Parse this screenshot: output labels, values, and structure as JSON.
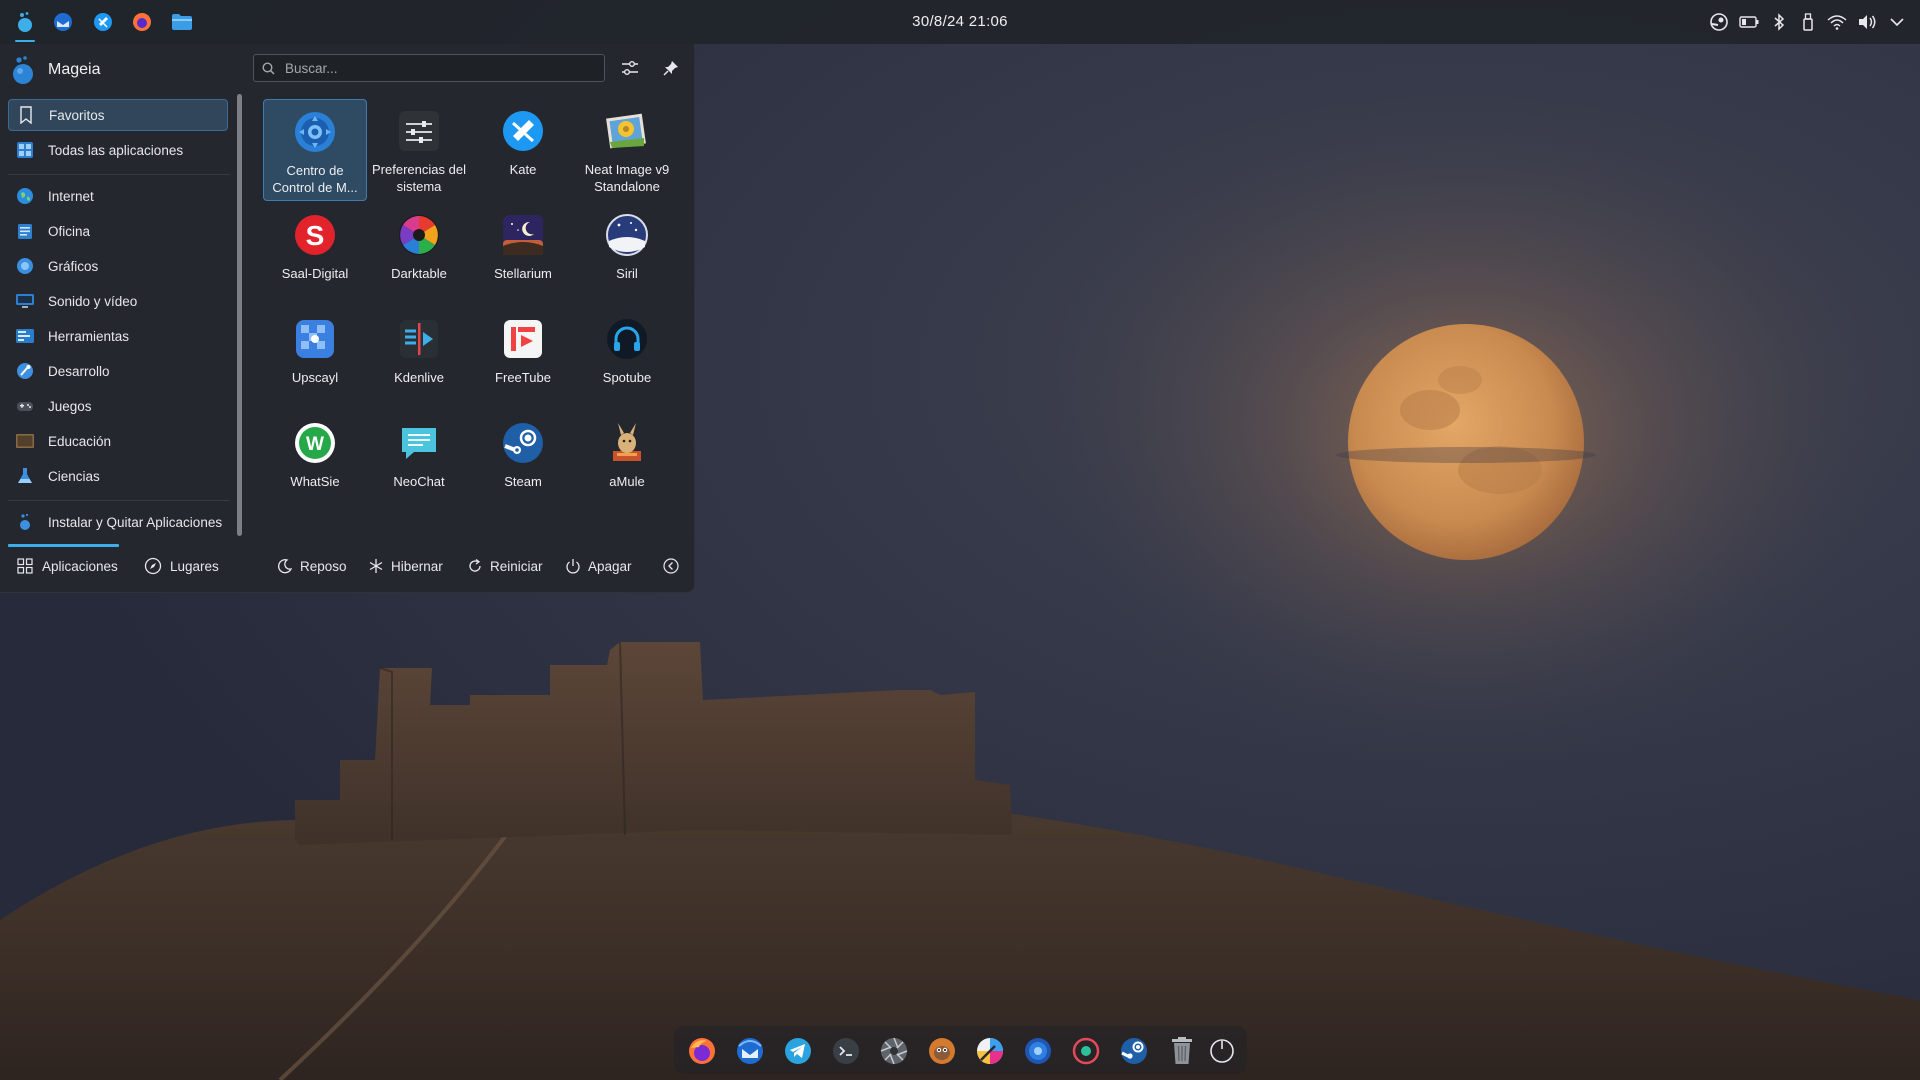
{
  "top_panel": {
    "launchers": [
      {
        "name": "kickoff-menu-icon",
        "color": "#3daee9"
      },
      {
        "name": "thunderbird-icon",
        "color": "#2a7fd6"
      },
      {
        "name": "kate-icon",
        "color": "#1d99f3"
      },
      {
        "name": "firefox-icon",
        "color": "#ff7139"
      },
      {
        "name": "dolphin-folder-icon",
        "color": "#3a9de6"
      }
    ],
    "clock": "30/8/24  21:06",
    "tray": [
      "steam-tray-icon",
      "battery-icon",
      "bluetooth-icon",
      "usb-device-icon",
      "wifi-icon",
      "volume-icon",
      "tray-expand-icon"
    ]
  },
  "menu": {
    "user": "Mageia",
    "search_placeholder": "Buscar...",
    "categories": [
      {
        "label": "Favoritos",
        "icon": "bookmark-icon",
        "selected": true
      },
      {
        "label": "Todas las aplicaciones",
        "icon": "all-apps-icon"
      },
      {
        "label": "Internet",
        "icon": "globe-icon"
      },
      {
        "label": "Oficina",
        "icon": "office-icon"
      },
      {
        "label": "Gráficos",
        "icon": "graphics-icon"
      },
      {
        "label": "Sonido y vídeo",
        "icon": "multimedia-icon"
      },
      {
        "label": "Herramientas",
        "icon": "tools-icon"
      },
      {
        "label": "Desarrollo",
        "icon": "development-icon"
      },
      {
        "label": "Juegos",
        "icon": "games-icon"
      },
      {
        "label": "Educación",
        "icon": "education-icon"
      },
      {
        "label": "Ciencias",
        "icon": "science-icon"
      },
      {
        "label": "Instalar y Quitar Aplicaciones",
        "icon": "package-manager-icon"
      }
    ],
    "favorites": [
      {
        "label": "Centro de Control de M...",
        "icon": "mageia-control-center-icon",
        "selected": true
      },
      {
        "label": "Preferencias del sistema",
        "icon": "system-settings-icon"
      },
      {
        "label": "Kate",
        "icon": "kate-icon"
      },
      {
        "label": "Neat Image v9 Standalone",
        "icon": "neat-image-icon"
      },
      {
        "label": "Saal-Digital",
        "icon": "saal-digital-icon"
      },
      {
        "label": "Darktable",
        "icon": "darktable-icon"
      },
      {
        "label": "Stellarium",
        "icon": "stellarium-icon"
      },
      {
        "label": "Siril",
        "icon": "siril-icon"
      },
      {
        "label": "Upscayl",
        "icon": "upscayl-icon"
      },
      {
        "label": "Kdenlive",
        "icon": "kdenlive-icon"
      },
      {
        "label": "FreeTube",
        "icon": "freetube-icon"
      },
      {
        "label": "Spotube",
        "icon": "spotube-icon"
      },
      {
        "label": "WhatSie",
        "icon": "whatsie-icon"
      },
      {
        "label": "NeoChat",
        "icon": "neochat-icon"
      },
      {
        "label": "Steam",
        "icon": "steam-icon"
      },
      {
        "label": "aMule",
        "icon": "amule-icon"
      }
    ],
    "footer": {
      "tabs": [
        "Aplicaciones",
        "Lugares"
      ],
      "active_tab": "Aplicaciones",
      "power": [
        "Reposo",
        "Hibernar",
        "Reiniciar",
        "Apagar"
      ]
    }
  },
  "dock": [
    "firefox-icon",
    "thunderbird-icon",
    "telegram-icon",
    "terminal-icon",
    "aperture-icon",
    "gimp-icon",
    "krita-icon",
    "browser-icon",
    "screen-recorder-icon",
    "steam-icon",
    "trash-icon",
    "power-icon"
  ],
  "colors": {
    "accent": "#3daee9",
    "panel": "#202329",
    "menu_bg": "#24272d"
  }
}
